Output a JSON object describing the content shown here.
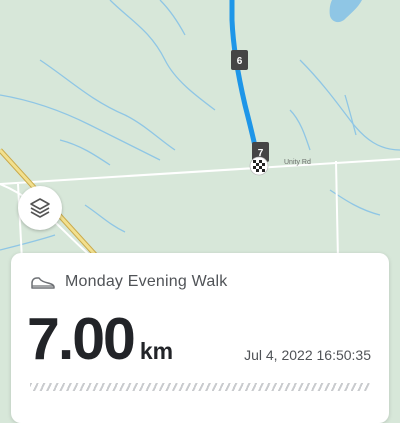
{
  "map": {
    "road_label": "Unity Rd",
    "markers": [
      "6",
      "7"
    ],
    "colors": {
      "background": "#d7e7d9",
      "water": "#8fc6e5",
      "route": "#1e96e8",
      "highway": "#e8d48a"
    }
  },
  "layers_button": {
    "icon": "layers-icon"
  },
  "activity": {
    "icon": "shoe-icon",
    "name": "Monday Evening Walk",
    "distance": "7.00",
    "unit": "km",
    "timestamp": "Jul 4, 2022 16:50:35"
  }
}
